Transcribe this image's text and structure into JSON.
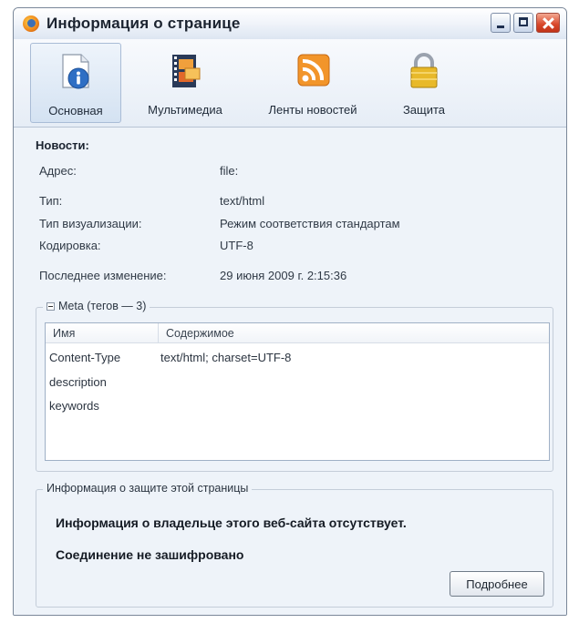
{
  "window": {
    "title": "Информация о странице"
  },
  "toolbar": {
    "items": [
      {
        "label": "Основная",
        "icon": "info-page-icon",
        "selected": true
      },
      {
        "label": "Мультимедиа",
        "icon": "film-media-icon",
        "selected": false
      },
      {
        "label": "Ленты новостей",
        "icon": "rss-feed-icon",
        "selected": false
      },
      {
        "label": "Защита",
        "icon": "lock-icon",
        "selected": false
      }
    ]
  },
  "general": {
    "heading": "Новости:",
    "rows": [
      {
        "label": "Адрес:",
        "value": "file:"
      },
      {
        "label": "Тип:",
        "value": "text/html"
      },
      {
        "label": "Тип визуализации:",
        "value": "Режим соответствия стандартам"
      },
      {
        "label": "Кодировка:",
        "value": "UTF-8"
      },
      {
        "label": "Последнее изменение:",
        "value": "29 июня 2009 г. 2:15:36"
      }
    ]
  },
  "meta": {
    "legend": "Meta (тегов — 3)",
    "columns": [
      "Имя",
      "Содержимое"
    ],
    "rows": [
      {
        "name": "Content-Type",
        "content": "text/html; charset=UTF-8"
      },
      {
        "name": "description",
        "content": ""
      },
      {
        "name": "keywords",
        "content": ""
      }
    ]
  },
  "security": {
    "legend": "Информация о защите этой страницы",
    "owner_text": "Информация о владельце этого веб-сайта отсутствует.",
    "connection_text": "Соединение не зашифровано",
    "details_button": "Подробнее"
  },
  "colors": {
    "window_bg": "#e8eff8",
    "close_button": "#d8472a",
    "rss_orange": "#f2952a",
    "info_blue": "#2f6fc4",
    "lock_gold": "#e8b92a"
  }
}
